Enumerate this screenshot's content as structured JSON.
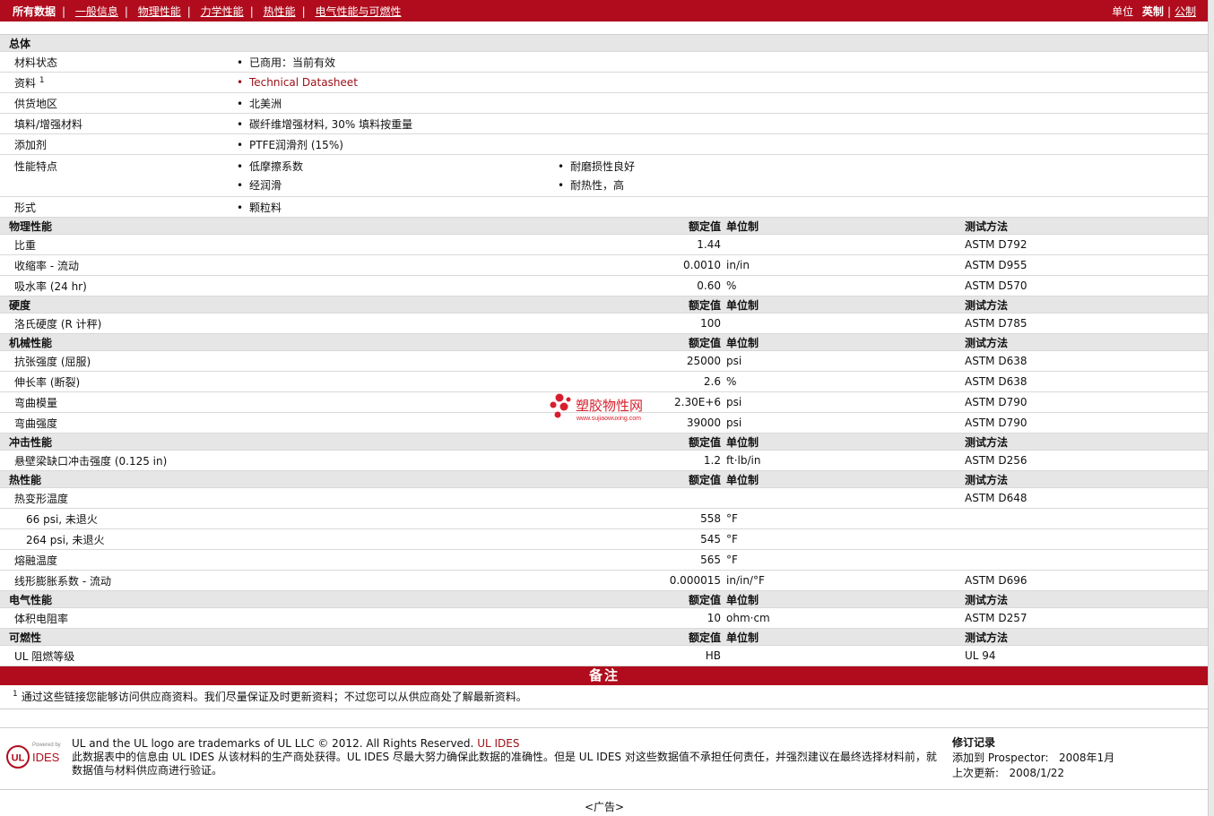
{
  "nav": {
    "items": [
      "所有数据",
      "一般信息",
      "物理性能",
      "力学性能",
      "热性能",
      "电气性能与可燃性"
    ],
    "unit_label": "单位",
    "unit_imperial": "英制",
    "unit_metric": "公制"
  },
  "general": {
    "title": "总体",
    "material_status_label": "材料状态",
    "material_status_value": "已商用：当前有效",
    "literature_label": "资料",
    "literature_sup": "1",
    "literature_value": "Technical Datasheet",
    "region_label": "供货地区",
    "region_value": "北美洲",
    "filler_label": "填料/增强材料",
    "filler_value": "碳纤维增强材料, 30% 填料按重量",
    "additive_label": "添加剂",
    "additive_value": "PTFE润滑剂 (15%)",
    "features_label": "性能特点",
    "features": [
      "低摩擦系数",
      "耐磨损性良好",
      "经润滑",
      "耐热性，高"
    ],
    "form_label": "形式",
    "form_value": "颗粒料"
  },
  "headers": {
    "value": "额定值",
    "unit": "单位制",
    "method": "测试方法"
  },
  "sections": {
    "physical": {
      "title": "物理性能",
      "rows": [
        {
          "name": "比重",
          "value": "1.44",
          "unit": "",
          "method": "ASTM D792"
        },
        {
          "name": "收缩率 - 流动",
          "value": "0.0010",
          "unit": "in/in",
          "method": "ASTM D955"
        },
        {
          "name": "吸水率 (24 hr)",
          "value": "0.60",
          "unit": "%",
          "method": "ASTM D570"
        }
      ]
    },
    "hardness": {
      "title": "硬度",
      "rows": [
        {
          "name": "洛氏硬度 (R 计秤)",
          "value": "100",
          "unit": "",
          "method": "ASTM D785"
        }
      ]
    },
    "mechanical": {
      "title": "机械性能",
      "rows": [
        {
          "name": "抗张强度 (屈服)",
          "value": "25000",
          "unit": "psi",
          "method": "ASTM D638"
        },
        {
          "name": "伸长率 (断裂)",
          "value": "2.6",
          "unit": "%",
          "method": "ASTM D638"
        },
        {
          "name": "弯曲模量",
          "value": "2.30E+6",
          "unit": "psi",
          "method": "ASTM D790"
        },
        {
          "name": "弯曲强度",
          "value": "39000",
          "unit": "psi",
          "method": "ASTM D790"
        }
      ]
    },
    "impact": {
      "title": "冲击性能",
      "rows": [
        {
          "name": "悬壁梁缺口冲击强度 (0.125 in)",
          "value": "1.2",
          "unit": "ft·lb/in",
          "method": "ASTM D256"
        }
      ]
    },
    "thermal": {
      "title": "热性能",
      "hdt_name": "热变形温度",
      "hdt_method": "ASTM D648",
      "hdt_66_name": "66 psi, 未退火",
      "hdt_66_value": "558",
      "hdt_66_unit": "°F",
      "hdt_264_name": "264 psi, 未退火",
      "hdt_264_value": "545",
      "hdt_264_unit": "°F",
      "melt_name": "熔融温度",
      "melt_value": "565",
      "melt_unit": "°F",
      "clte_name": "线形膨胀系数 - 流动",
      "clte_value": "0.000015",
      "clte_unit": "in/in/°F",
      "clte_method": "ASTM D696"
    },
    "electrical": {
      "title": "电气性能",
      "rows": [
        {
          "name": "体积电阻率",
          "value": "10",
          "unit": "ohm·cm",
          "method": "ASTM D257"
        }
      ]
    },
    "flammability": {
      "title": "可燃性",
      "rows": [
        {
          "name": "UL 阻燃等级",
          "value": "HB",
          "unit": "",
          "method": "UL 94"
        }
      ]
    }
  },
  "notes": {
    "title": "备注",
    "footnote_sup": "1",
    "footnote_text": "通过这些链接您能够访问供应商资料。我们尽量保证及时更新资料；不过您可以从供应商处了解最新资料。"
  },
  "footer": {
    "logo_powered": "Powered by",
    "logo_ul": "UL",
    "logo_ides": "IDES",
    "trademark": "UL and the UL logo are trademarks of UL LLC © 2012. All Rights Reserved.",
    "ul_ides_link": "UL IDES",
    "disclaimer": "此数据表中的信息由 UL IDES 从该材料的生产商处获得。UL IDES 尽最大努力确保此数据的准确性。但是 UL IDES 对这些数据值不承担任何责任，并强烈建议在最终选择材料前，就数据值与材料供应商进行验证。",
    "revision_title": "修订记录",
    "added_label": "添加到 Prospector:",
    "added_value": "2008年1月",
    "updated_label": "上次更新:",
    "updated_value": "2008/1/22",
    "ad": "<广告>"
  },
  "watermark": {
    "name": "塑胶物性网",
    "url": "www.sujiaowuxing.com",
    "color": "#d81e2c"
  },
  "colors": {
    "brand": "#b00c1d",
    "header_bg": "#e6e6e6",
    "link": "#9b0f17"
  }
}
